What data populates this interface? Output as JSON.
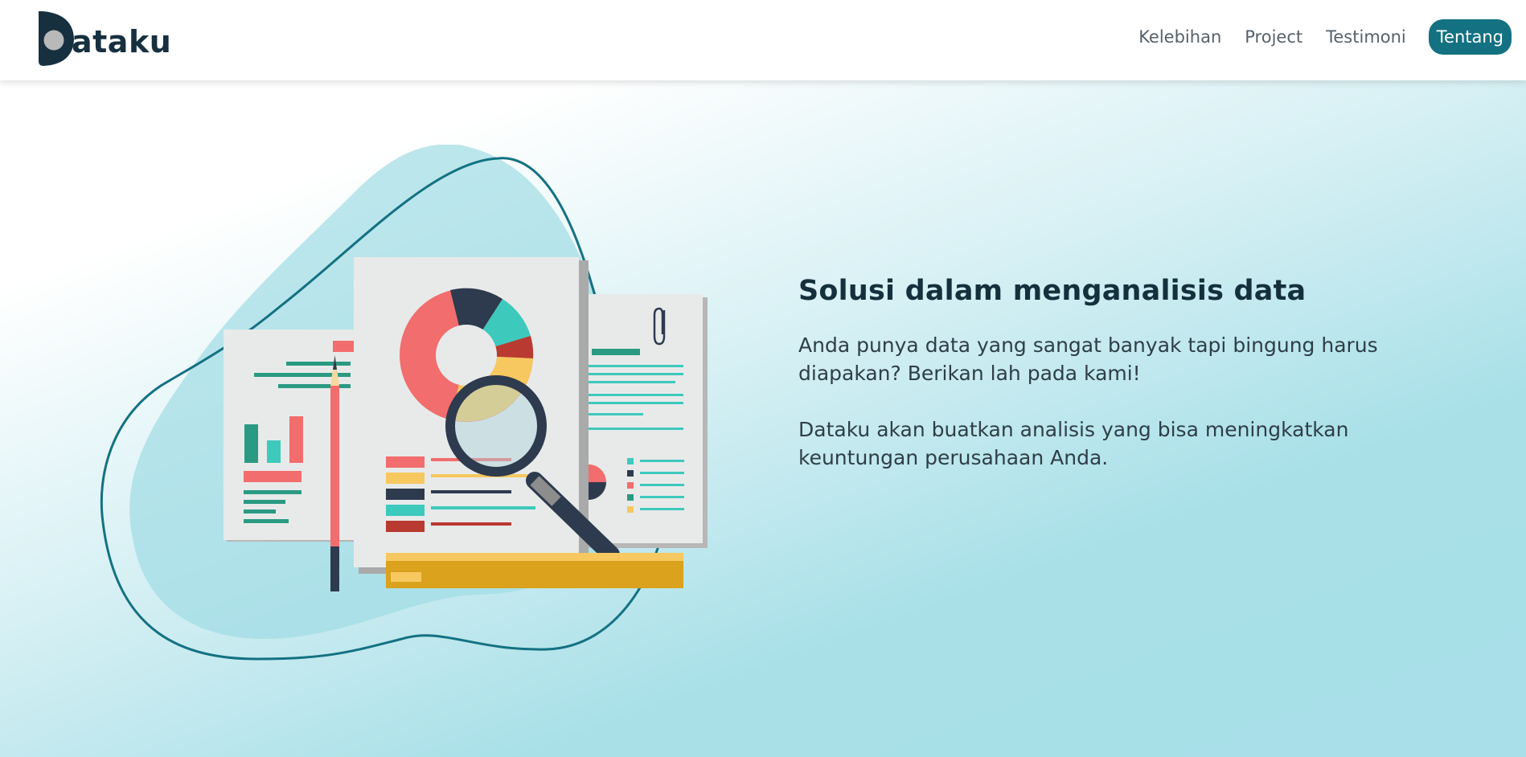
{
  "brand": {
    "name": "ataku",
    "icon": "dataku-logo-d-icon"
  },
  "nav": {
    "items": [
      {
        "label": "Kelebihan"
      },
      {
        "label": "Project"
      },
      {
        "label": "Testimoni"
      },
      {
        "label": "Tentang",
        "active": true
      }
    ]
  },
  "hero": {
    "title": "Solusi dalam menganalisis data",
    "paragraph1": "Anda punya data yang sangat banyak tapi bingung harus diapakan? Berikan lah pada kami!",
    "paragraph2": "Dataku akan buatkan analisis yang bisa meningkatkan keuntungan perusahaan Anda.",
    "illustration": "data-analysis-illustration"
  },
  "colors": {
    "accent": "#137182",
    "heading": "#15303d",
    "blob": "#9fdbe4",
    "coral": "#f26d6d",
    "navy": "#2e3a4e",
    "teal": "#3ec9bd",
    "yellow": "#f6c85f",
    "green": "#2a9a83"
  }
}
